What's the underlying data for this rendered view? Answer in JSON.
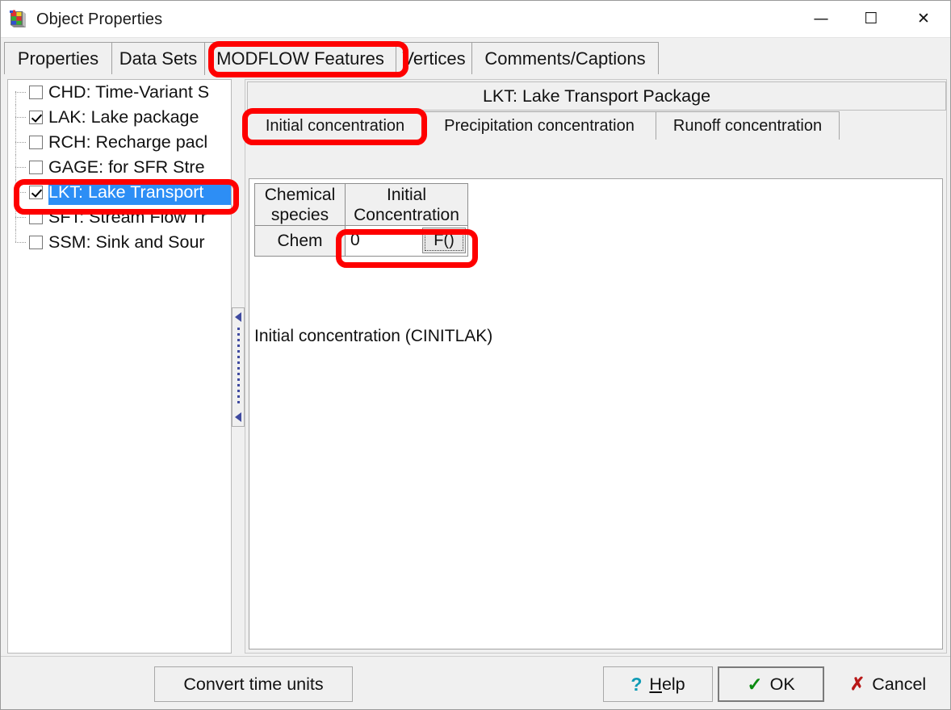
{
  "window": {
    "title": "Object Properties",
    "icon": "blocks-icon",
    "controls": {
      "minimize": "—",
      "maximize": "☐",
      "close": "✕"
    }
  },
  "main_tabs": [
    {
      "label": "Properties",
      "selected": false
    },
    {
      "label": "Data Sets",
      "selected": false
    },
    {
      "label": "MODFLOW Features",
      "selected": true
    },
    {
      "label": "Vertices",
      "selected": false
    },
    {
      "label": "Comments/Captions",
      "selected": false
    }
  ],
  "tree": {
    "items": [
      {
        "label": "CHD: Time-Variant S",
        "checked": false,
        "selected": false
      },
      {
        "label": "LAK: Lake package",
        "checked": true,
        "selected": false
      },
      {
        "label": "RCH: Recharge pacl",
        "checked": false,
        "selected": false
      },
      {
        "label": "GAGE: for SFR Stre",
        "checked": false,
        "selected": false
      },
      {
        "label": "LKT: Lake Transport",
        "checked": true,
        "selected": true
      },
      {
        "label": "SFT: Stream Flow Tr",
        "checked": false,
        "selected": false
      },
      {
        "label": "SSM: Sink and Sour",
        "checked": false,
        "selected": false
      }
    ]
  },
  "package": {
    "header": "LKT: Lake Transport Package",
    "sub_tabs": [
      {
        "label": "Initial concentration",
        "selected": true
      },
      {
        "label": "Precipitation concentration",
        "selected": false
      },
      {
        "label": "Runoff concentration",
        "selected": false
      }
    ],
    "caption": "Initial concentration (CINITLAK)"
  },
  "grid": {
    "columns": [
      "Chemical species",
      "Initial Concentration"
    ],
    "rows": [
      {
        "species": "Chem",
        "value": "0",
        "formula_button": "F()"
      }
    ]
  },
  "footer": {
    "convert": "Convert time units",
    "help": "Help",
    "help_accel": "H",
    "help_rest": "elp",
    "ok": "OK",
    "cancel": "Cancel"
  },
  "colors": {
    "selection_blue": "#2d8ef5",
    "annotation_red": "#fe0000",
    "dialog_bg": "#f0f0f0",
    "check_green": "#0a8a10",
    "cancel_red": "#b81818",
    "help_cyan": "#0f9bb5"
  }
}
